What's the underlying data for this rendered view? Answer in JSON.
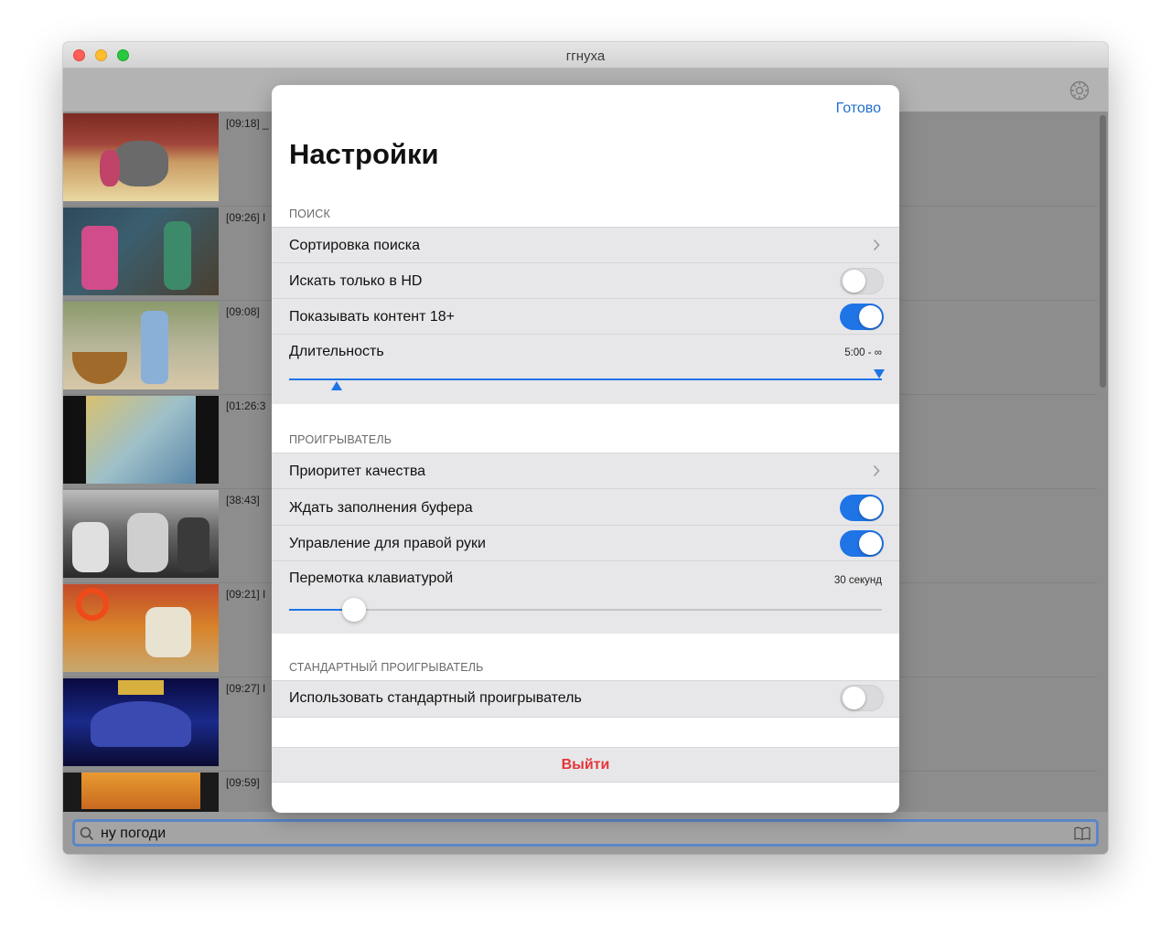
{
  "window": {
    "title": "ггнуха"
  },
  "videos": [
    {
      "duration": "[09:18] _"
    },
    {
      "duration": "[09:26] I"
    },
    {
      "duration": "[09:08]"
    },
    {
      "duration": "[01:26:3"
    },
    {
      "duration": "[38:43]"
    },
    {
      "duration": "[09:21] I"
    },
    {
      "duration": "[09:27] I"
    },
    {
      "duration": "[09:59]"
    }
  ],
  "search": {
    "value": "ну погоди"
  },
  "settings": {
    "done_label": "Готово",
    "title": "Настройки",
    "search_section": {
      "header": "ПОИСК",
      "sort_label": "Сортировка поиска",
      "hd_only": {
        "label": "Искать только в HD",
        "on": false
      },
      "adult": {
        "label": "Показывать контент 18+",
        "on": true
      },
      "duration": {
        "label": "Длительность",
        "value": "5:00 - ∞",
        "range_min_fraction": 0.08,
        "range_max_fraction": 1.0
      }
    },
    "player_section": {
      "header": "ПРОИГРЫВАТЕЛЬ",
      "quality_label": "Приоритет качества",
      "buffer": {
        "label": "Ждать заполнения буфера",
        "on": true
      },
      "right_hand": {
        "label": "Управление для правой руки",
        "on": true
      },
      "keyboard_seek": {
        "label": "Перемотка клавиатурой",
        "value": "30 секунд",
        "fraction": 0.11
      }
    },
    "standard_section": {
      "header": "СТАНДАРТНЫЙ ПРОИГРЫВАТЕЛЬ",
      "use_standard": {
        "label": "Использовать стандартный проигрыватель",
        "on": false
      }
    },
    "logout_label": "Выйти"
  },
  "colors": {
    "accent": "#1f74e6",
    "destructive": "#e5353b",
    "link": "#1f6fd1"
  }
}
